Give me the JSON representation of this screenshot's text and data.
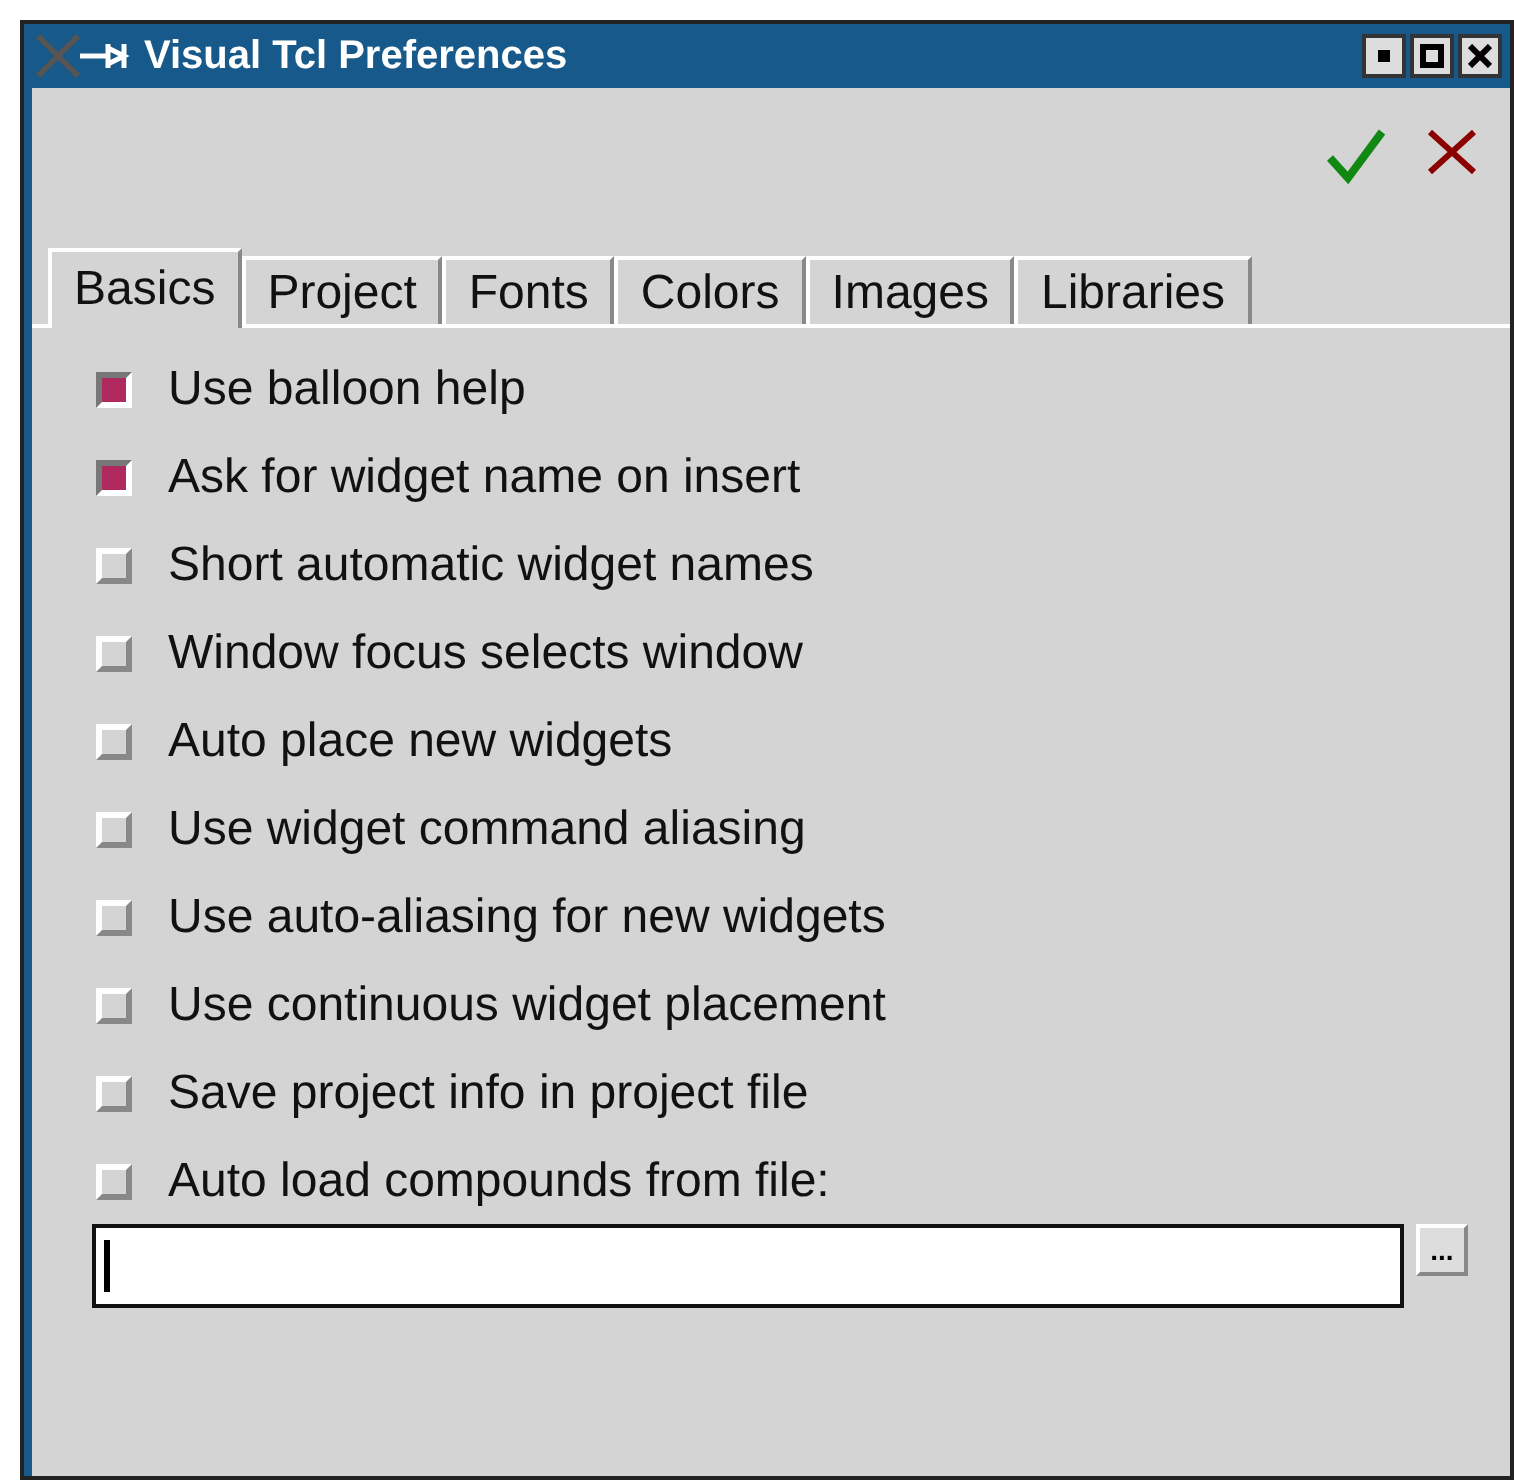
{
  "window": {
    "title": "Visual Tcl Preferences"
  },
  "tabs": [
    {
      "label": "Basics",
      "selected": true
    },
    {
      "label": "Project",
      "selected": false
    },
    {
      "label": "Fonts",
      "selected": false
    },
    {
      "label": "Colors",
      "selected": false
    },
    {
      "label": "Images",
      "selected": false
    },
    {
      "label": "Libraries",
      "selected": false
    }
  ],
  "options": [
    {
      "label": "Use balloon help",
      "checked": true
    },
    {
      "label": "Ask for widget name on insert",
      "checked": true
    },
    {
      "label": "Short automatic widget names",
      "checked": false
    },
    {
      "label": "Window focus selects window",
      "checked": false
    },
    {
      "label": "Auto place new widgets",
      "checked": false
    },
    {
      "label": "Use widget command aliasing",
      "checked": false
    },
    {
      "label": "Use auto-aliasing for new widgets",
      "checked": false
    },
    {
      "label": "Use continuous widget placement",
      "checked": false
    },
    {
      "label": "Save project info in project file",
      "checked": false
    },
    {
      "label": "Auto load compounds from file:",
      "checked": false
    }
  ],
  "browse_button": {
    "label": "..."
  }
}
